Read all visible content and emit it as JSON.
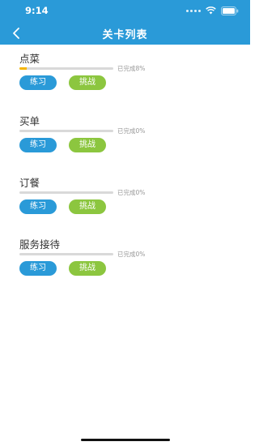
{
  "status_bar": {
    "time": "9:14"
  },
  "nav": {
    "title": "关卡列表"
  },
  "levels": [
    {
      "name": "点菜",
      "progress_text": "已完成8%",
      "progress": 0.08,
      "practice_label": "练习",
      "challenge_label": "挑战"
    },
    {
      "name": "买单",
      "progress_text": "已完成0%",
      "progress": 0,
      "practice_label": "练习",
      "challenge_label": "挑战"
    },
    {
      "name": "订餐",
      "progress_text": "已完成0%",
      "progress": 0,
      "practice_label": "练习",
      "challenge_label": "挑战"
    },
    {
      "name": "服务接待",
      "progress_text": "已完成0%",
      "progress": 0,
      "practice_label": "练习",
      "challenge_label": "挑战"
    }
  ],
  "colors": {
    "header": "#2a9ad8",
    "practice": "#2a9ad8",
    "challenge": "#8cc63f",
    "progress_fill": "#f5b400"
  }
}
